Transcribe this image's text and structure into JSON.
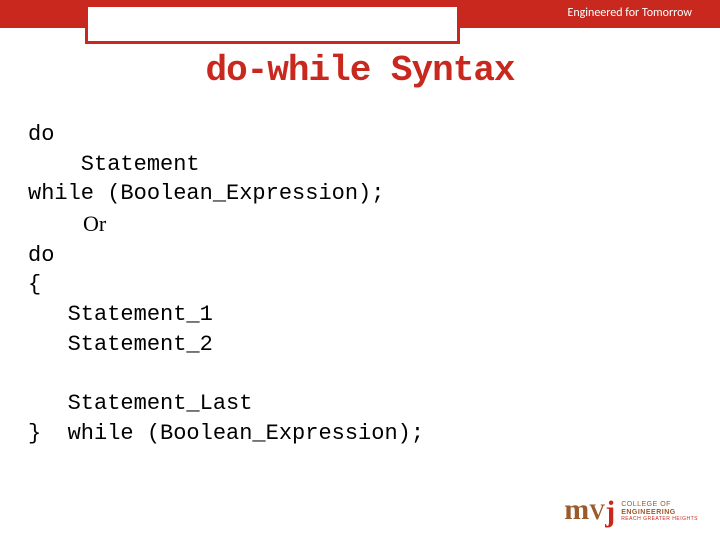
{
  "header": {
    "tagline": "Engineered for Tomorrow",
    "title": "do-while Syntax"
  },
  "code": {
    "l1": "do",
    "l2": "    Statement",
    "l3": "while (Boolean_Expression);",
    "or": "          Or",
    "l4": "do",
    "l5": "{",
    "l6": "   Statement_1",
    "l7": "   Statement_2",
    "blank": "",
    "l8": "   Statement_Last",
    "l9": "}  while (Boolean_Expression);"
  },
  "logo": {
    "m": "m",
    "v": "V",
    "j": "j",
    "line1": "COLLEGE OF",
    "line2": "ENGINEERING",
    "line3": "REACH GREATER HEIGHTS"
  }
}
